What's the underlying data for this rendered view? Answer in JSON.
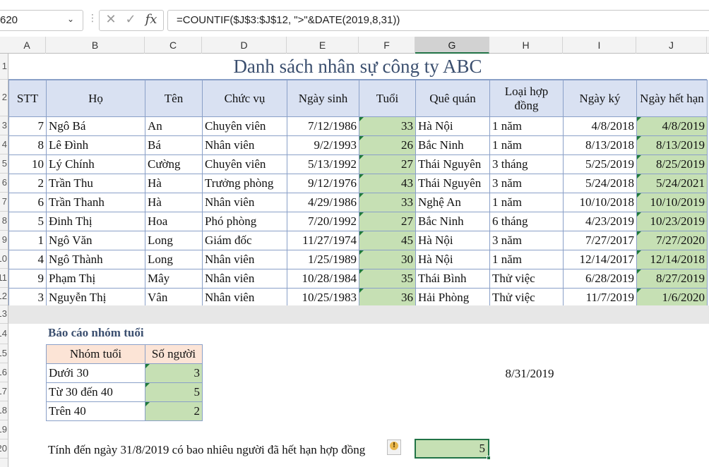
{
  "formula_bar": {
    "name_box": "620",
    "cancel_icon": "x-icon",
    "enter_icon": "check-icon",
    "fx_label": "fx",
    "formula": "=COUNTIF($J$3:$J$12, \">\"&DATE(2019,8,31))"
  },
  "columns": [
    "A",
    "B",
    "C",
    "D",
    "E",
    "F",
    "G",
    "H",
    "I",
    "J"
  ],
  "selected_column": "G",
  "rows": [
    "1",
    "2",
    "3",
    "4",
    "5",
    "6",
    "7",
    "8",
    "9",
    "10",
    "11",
    "12",
    "13",
    "14",
    "15",
    "16",
    "17",
    "18",
    "19",
    "20"
  ],
  "title": "Danh sách nhân sự công ty ABC",
  "table": {
    "headers": [
      "STT",
      "Họ",
      "Tên",
      "Chức vụ",
      "Ngày sinh",
      "Tuổi",
      "Quê quán",
      "Loại hợp đồng",
      "Ngày ký",
      "Ngày hết hạn"
    ],
    "rows": [
      [
        "7",
        "Ngô Bá",
        "An",
        "Chuyên viên",
        "7/12/1986",
        "33",
        "Hà Nội",
        "1 năm",
        "4/8/2018",
        "4/8/2019"
      ],
      [
        "8",
        "Lê Đình",
        "Bá",
        "Nhân viên",
        "9/2/1993",
        "26",
        "Bắc Ninh",
        "1 năm",
        "8/13/2018",
        "8/13/2019"
      ],
      [
        "10",
        "Lý Chính",
        "Cường",
        "Chuyên viên",
        "5/13/1992",
        "27",
        "Thái Nguyên",
        "3 tháng",
        "5/25/2019",
        "8/25/2019"
      ],
      [
        "2",
        "Trần Thu",
        "Hà",
        "Trưởng phòng",
        "9/12/1976",
        "43",
        "Thái Nguyên",
        "3 năm",
        "5/24/2018",
        "5/24/2021"
      ],
      [
        "6",
        "Trần Thanh",
        "Hà",
        "Nhân viên",
        "4/29/1986",
        "33",
        "Nghệ An",
        "1 năm",
        "10/10/2018",
        "10/10/2019"
      ],
      [
        "5",
        "Đinh Thị",
        "Hoa",
        "Phó phòng",
        "7/20/1992",
        "27",
        "Bắc Ninh",
        "6 tháng",
        "4/23/2019",
        "10/23/2019"
      ],
      [
        "1",
        "Ngô Văn",
        "Long",
        "Giám đốc",
        "11/27/1974",
        "45",
        "Hà Nội",
        "3 năm",
        "7/27/2017",
        "7/27/2020"
      ],
      [
        "4",
        "Ngô Thành",
        "Long",
        "Nhân viên",
        "1/25/1989",
        "30",
        "Hà Nội",
        "1 năm",
        "12/14/2017",
        "12/14/2018"
      ],
      [
        "9",
        "Phạm Thị",
        "Mây",
        "Nhân viên",
        "10/28/1984",
        "35",
        "Thái Bình",
        "Thử việc",
        "6/28/2019",
        "8/27/2019"
      ],
      [
        "3",
        "Nguyễn Thị",
        "Vân",
        "Nhân viên",
        "10/25/1983",
        "36",
        "Hải Phòng",
        "Thử việc",
        "11/7/2019",
        "1/6/2020"
      ]
    ]
  },
  "report": {
    "title": "Báo cáo nhóm tuổi",
    "headers": [
      "Nhóm tuổi",
      "Số người"
    ],
    "rows": [
      [
        "Dưới 30",
        "3"
      ],
      [
        "Từ 30 đến 40",
        "5"
      ],
      [
        "Trên 40",
        "2"
      ]
    ]
  },
  "date_value": "8/31/2019",
  "question": "Tính đến ngày 31/8/2019 có bao nhiêu người đã hết hạn hợp đồng",
  "warning_icon": "warning-icon",
  "answer": "5",
  "colors": {
    "header_fill": "#d9e1f2",
    "green_fill": "#c6e0b4",
    "report_header_fill": "#fce4d6",
    "title_color": "#3b4f6f",
    "selection": "#217346"
  }
}
